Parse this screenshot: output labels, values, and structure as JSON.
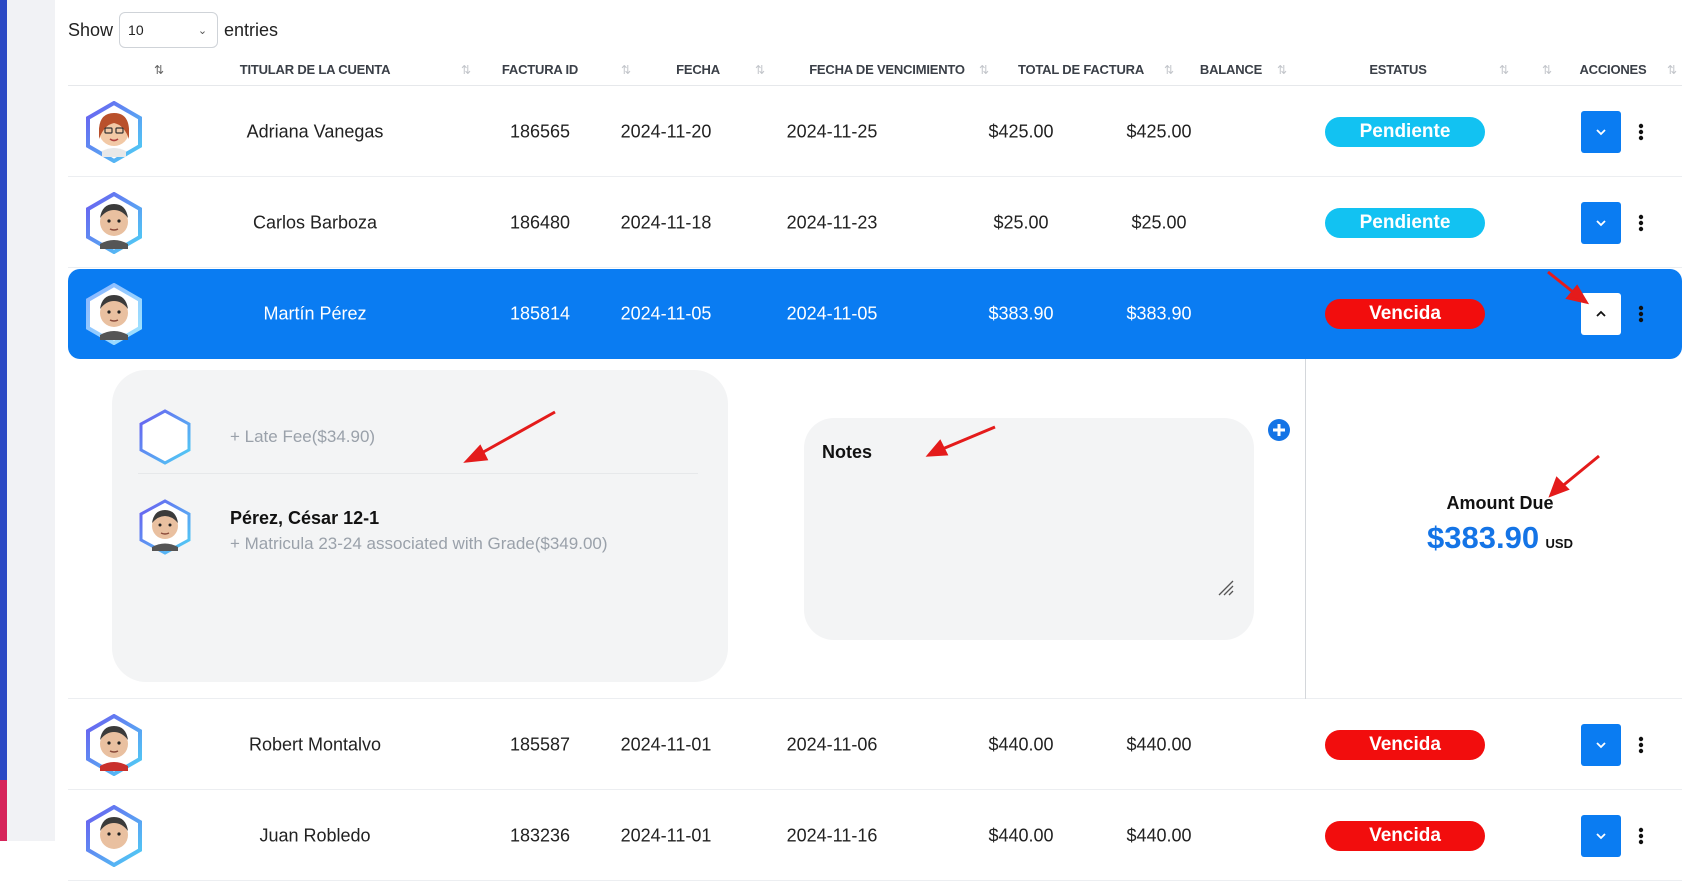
{
  "entries": {
    "show_label": "Show",
    "selected": "10",
    "suffix": "entries"
  },
  "columns": {
    "account_holder": "TITULAR DE LA CUENTA",
    "invoice_id": "FACTURA ID",
    "date": "FECHA",
    "due_date": "FECHA DE VENCIMIENTO",
    "invoice_total": "TOTAL DE FACTURA",
    "balance": "BALANCE",
    "status": "ESTATUS",
    "actions": "ACCIONES"
  },
  "rows": [
    {
      "name": "Adriana Vanegas",
      "invoice_id": "186565",
      "date": "2024-11-20",
      "due_date": "2024-11-25",
      "total": "$425.00",
      "balance": "$425.00",
      "status": "Pendiente",
      "status_color": "#12c2f2"
    },
    {
      "name": "Carlos Barboza",
      "invoice_id": "186480",
      "date": "2024-11-18",
      "due_date": "2024-11-23",
      "total": "$25.00",
      "balance": "$25.00",
      "status": "Pendiente",
      "status_color": "#12c2f2"
    },
    {
      "name": "Martín Pérez",
      "invoice_id": "185814",
      "date": "2024-11-05",
      "due_date": "2024-11-05",
      "total": "$383.90",
      "balance": "$383.90",
      "status": "Vencida",
      "status_color": "#f20d0d",
      "expanded": true
    },
    {
      "name": "Robert Montalvo",
      "invoice_id": "185587",
      "date": "2024-11-01",
      "due_date": "2024-11-06",
      "total": "$440.00",
      "balance": "$440.00",
      "status": "Vencida",
      "status_color": "#f20d0d"
    },
    {
      "name": "Juan Robledo",
      "invoice_id": "183236",
      "date": "2024-11-01",
      "due_date": "2024-11-16",
      "total": "$440.00",
      "balance": "$440.00",
      "status": "Vencida",
      "status_color": "#f20d0d"
    }
  ],
  "detail": {
    "items": [
      {
        "text": "+ Late Fee($34.90)"
      },
      {
        "title": "Pérez, César 12-1",
        "text": "+ Matricula 23-24 associated with Grade($349.00)"
      }
    ],
    "notes_title": "Notes",
    "amount_due_label": "Amount Due",
    "amount_due_value": "$383.90",
    "amount_due_currency": "USD"
  },
  "colors": {
    "primary": "#0a7cf2",
    "pending": "#12c2f2",
    "overdue": "#f20d0d",
    "amount": "#1474e6",
    "sidebar": "#2b49c4",
    "annotation_arrow": "#e41b1b"
  },
  "icons": [
    "sort-icon",
    "chevron-down-icon",
    "chevron-up-icon",
    "more-vertical-icon",
    "plus-circle-icon",
    "resize-handle-icon",
    "hexagon-avatar-icon"
  ]
}
